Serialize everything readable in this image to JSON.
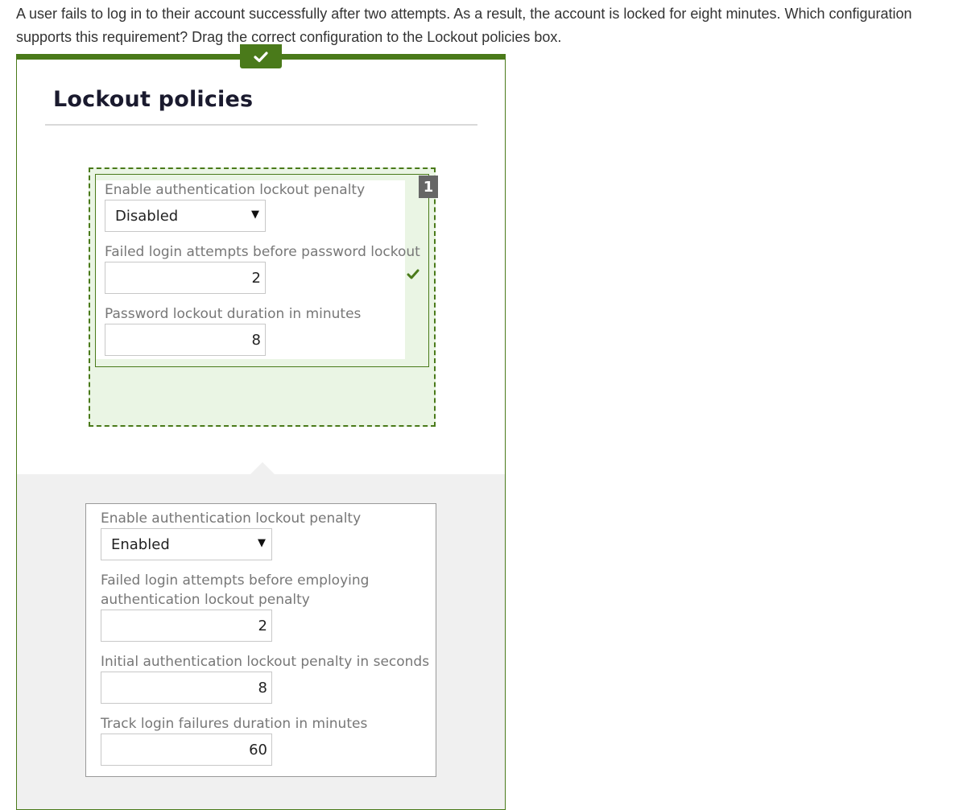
{
  "question": {
    "text": "A user fails to log in to their account successfully after two attempts. As a result, the account is locked for eight minutes. Which configuration supports this requirement? Drag the correct configuration to the Lockout policies box."
  },
  "panel": {
    "title": "Lockout policies",
    "status_icon": "checkmark-icon",
    "accent_color": "#4a7a1a"
  },
  "placed_config": {
    "badge": "1",
    "status_icon": "checkmark-icon",
    "fields": {
      "penalty_label": "Enable authentication lockout penalty",
      "penalty_value": "Disabled",
      "attempts_label": "Failed login attempts before password lockout",
      "attempts_value": "2",
      "duration_label": "Password lockout duration in minutes",
      "duration_value": "8"
    }
  },
  "option_config": {
    "fields": {
      "penalty_label": "Enable authentication lockout penalty",
      "penalty_value": "Enabled",
      "attempts_label": "Failed login attempts before employing authentication lockout penalty",
      "attempts_value": "2",
      "initial_penalty_label": "Initial authentication lockout penalty in seconds",
      "initial_penalty_value": "8",
      "track_label": "Track login failures duration in minutes",
      "track_value": "60"
    }
  },
  "icons": {
    "dropdown_arrow": "▼"
  }
}
